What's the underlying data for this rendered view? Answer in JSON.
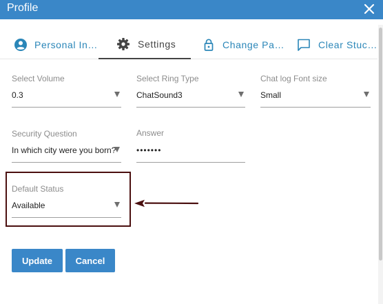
{
  "dialog": {
    "title": "Profile"
  },
  "tabs": [
    {
      "label": "Personal In…",
      "icon": "account-circle-icon",
      "active": false
    },
    {
      "label": "Settings",
      "icon": "gear-icon",
      "active": true
    },
    {
      "label": "Change Pa…",
      "icon": "lock-icon",
      "active": false
    },
    {
      "label": "Clear Stuc…",
      "icon": "chat-bubble-icon",
      "active": false
    }
  ],
  "fields": {
    "volume": {
      "label": "Select Volume",
      "value": "0.3"
    },
    "ring_type": {
      "label": "Select Ring Type",
      "value": "ChatSound3"
    },
    "font_size": {
      "label": "Chat log Font size",
      "value": "Small"
    },
    "security_question": {
      "label": "Security Question",
      "value": "In which city were you born?"
    },
    "answer": {
      "label": "Answer",
      "value": "•••••••"
    },
    "default_status": {
      "label": "Default Status",
      "value": "Available"
    }
  },
  "buttons": {
    "update": "Update",
    "cancel": "Cancel"
  },
  "colors": {
    "accent": "#3a87c8",
    "tab_text": "#2a86b8",
    "annotation": "#4a0f0f"
  }
}
